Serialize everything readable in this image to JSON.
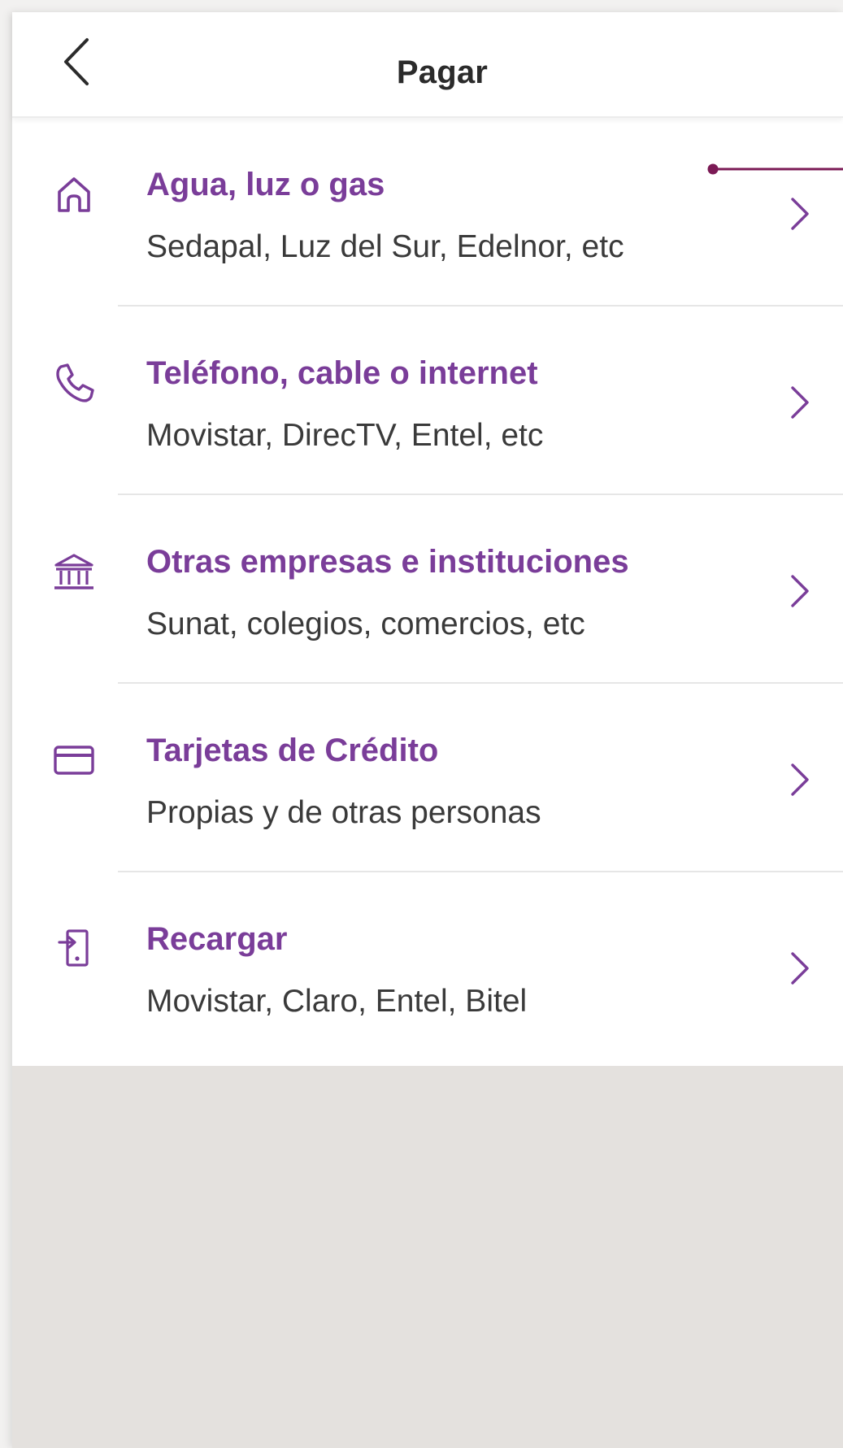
{
  "header": {
    "title": "Pagar",
    "back_icon": "chevron-left-icon"
  },
  "colors": {
    "accent": "#7a3d99",
    "annotation": "#7b1a55",
    "text": "#3a3a3a",
    "empty_area": "#e4e1de"
  },
  "items": [
    {
      "title": "Agua, luz o gas",
      "subtitle": "Sedapal, Luz del Sur, Edelnor, etc",
      "icon": "home-icon"
    },
    {
      "title": "Teléfono, cable o internet",
      "subtitle": "Movistar, DirecTV, Entel, etc",
      "icon": "phone-icon"
    },
    {
      "title": "Otras empresas e instituciones",
      "subtitle": "Sunat, colegios, comercios, etc",
      "icon": "bank-icon"
    },
    {
      "title": "Tarjetas de Crédito",
      "subtitle": "Propias y de otras personas",
      "icon": "credit-card-icon"
    },
    {
      "title": "Recargar",
      "subtitle": "Movistar, Claro, Entel, Bitel",
      "icon": "recharge-icon"
    }
  ]
}
